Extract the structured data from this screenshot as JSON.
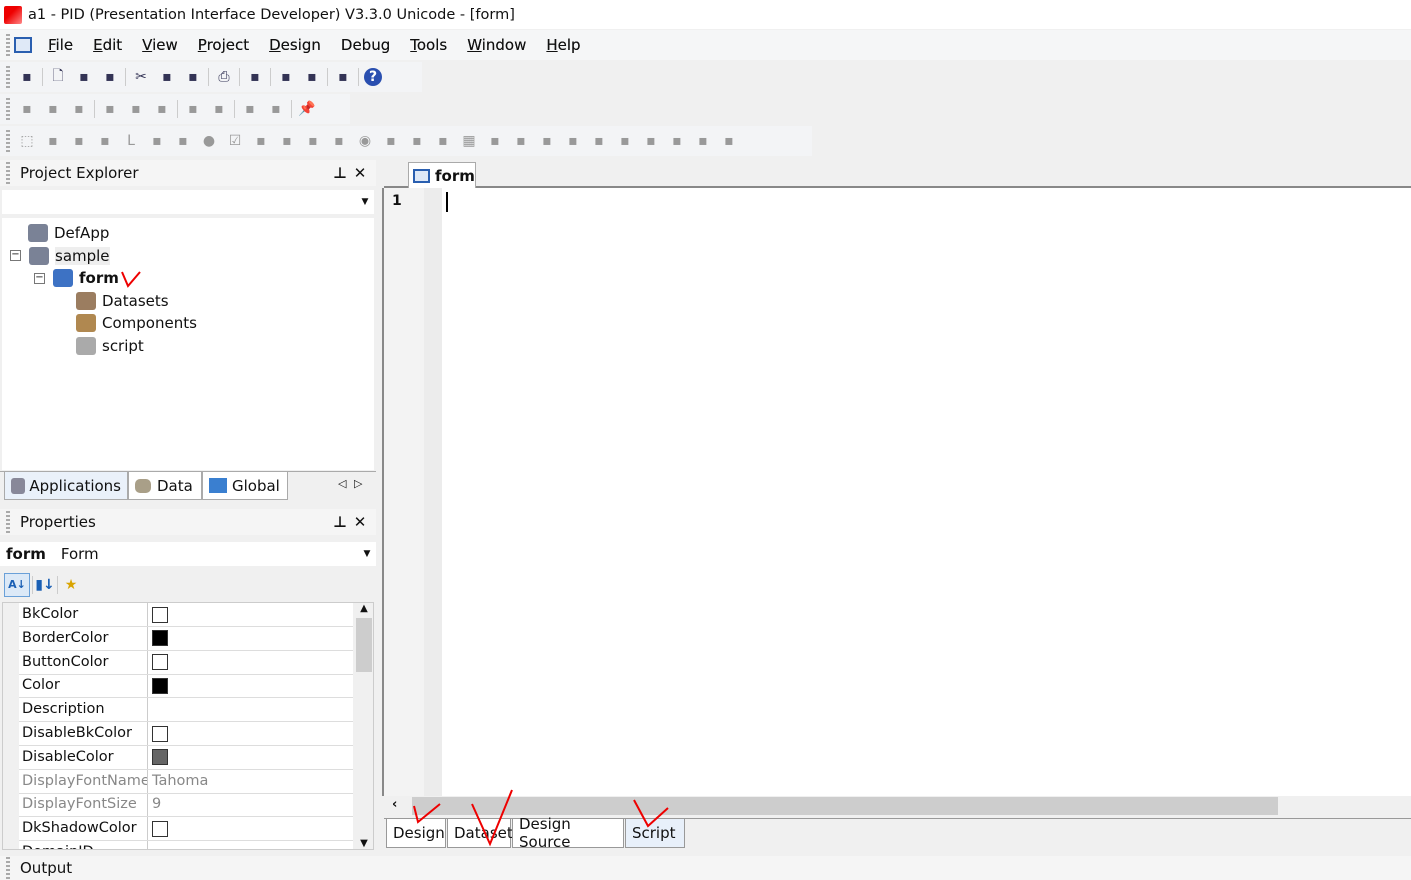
{
  "window": {
    "title": "a1 - PID (Presentation Interface Developer) V3.3.0 Unicode - [form]"
  },
  "menu": [
    {
      "label": "File",
      "u": "F",
      "rest": "ile"
    },
    {
      "label": "Edit",
      "u": "E",
      "rest": "dit"
    },
    {
      "label": "View",
      "u": "V",
      "rest": "iew"
    },
    {
      "label": "Project",
      "u": "P",
      "rest": "roject"
    },
    {
      "label": "Design",
      "u": "D",
      "rest": "esign"
    },
    {
      "label": "Debug",
      "u": "Debug",
      "rest": ""
    },
    {
      "label": "Tools",
      "u": "T",
      "rest": "ools"
    },
    {
      "label": "Window",
      "u": "W",
      "rest": "indow"
    },
    {
      "label": "Help",
      "u": "H",
      "rest": "elp"
    }
  ],
  "toolbars": [
    [
      "open-project-icon",
      "|",
      "new-icon",
      "save-icon",
      "save-all-icon",
      "|",
      "cut-icon",
      "copy-icon",
      "paste-icon",
      "|",
      "print-icon",
      "|",
      "build-icon",
      "|",
      "debug-icon",
      "run-icon",
      "|",
      "tools-icon",
      "|",
      "help-icon"
    ],
    [
      "align-left-icon",
      "align-center-icon",
      "align-right-icon",
      "|",
      "align-top-icon",
      "align-middle-icon",
      "align-bottom-icon",
      "|",
      "same-width-icon",
      "same-height-icon",
      "|",
      "h-spacing-icon",
      "v-spacing-icon",
      "|",
      "pin-icon"
    ],
    [
      "select-pointer-icon",
      "spin-icon",
      "mask-edit-icon",
      "button-icon",
      "static-icon",
      "edit-icon",
      "shape-icon",
      "circle-icon",
      "checkbox-icon",
      "image-icon",
      "div-icon",
      "list-icon",
      "calendar-icon",
      "radio-icon",
      "combo-icon",
      "field-icon",
      "tree-icon",
      "grid-icon",
      "tab-icon",
      "file-icon",
      "menu-icon",
      "group-icon",
      "graphic-icon",
      "activex-icon",
      "web-icon",
      "table-icon",
      "layout-icon",
      "custom-icon"
    ]
  ],
  "project_explorer": {
    "title": "Project Explorer",
    "combo_value": "",
    "tree": [
      {
        "label": "DefApp",
        "icon": "application-icon"
      },
      {
        "label": "sample",
        "icon": "application-icon"
      },
      {
        "label": "form",
        "icon": "form-icon"
      },
      {
        "label": "Datasets",
        "icon": "datasets-icon"
      },
      {
        "label": "Components",
        "icon": "components-icon"
      },
      {
        "label": "script",
        "icon": "script-icon"
      }
    ],
    "tabs": [
      {
        "label": "Applications"
      },
      {
        "label": "Data"
      },
      {
        "label": "Global"
      }
    ]
  },
  "properties": {
    "title": "Properties",
    "object_name": "form",
    "object_type": "Form",
    "rows": [
      {
        "name": "BkColor",
        "value": "",
        "swatch": "#ffffff"
      },
      {
        "name": "BorderColor",
        "value": "",
        "swatch": "#000000"
      },
      {
        "name": "ButtonColor",
        "value": "",
        "swatch": "#ffffff"
      },
      {
        "name": "Color",
        "value": "",
        "swatch": "#000000"
      },
      {
        "name": "Description",
        "value": ""
      },
      {
        "name": "DisableBkColor",
        "value": "",
        "swatch": "#ffffff"
      },
      {
        "name": "DisableColor",
        "value": "",
        "swatch": "#666666"
      },
      {
        "name": "DisplayFontName",
        "value": "Tahoma",
        "dim": true
      },
      {
        "name": "DisplayFontSize",
        "value": "9",
        "dim": true
      },
      {
        "name": "DkShadowColor",
        "value": "",
        "swatch": "#ffffff"
      },
      {
        "name": "DomainID",
        "value": ""
      }
    ]
  },
  "editor": {
    "tab": "form",
    "line_number": "1",
    "bottom_tabs": [
      {
        "label": "Design"
      },
      {
        "label": "Dataset"
      },
      {
        "label": "Design Source"
      },
      {
        "label": "Script",
        "active": true
      }
    ]
  },
  "output": {
    "title": "Output"
  }
}
